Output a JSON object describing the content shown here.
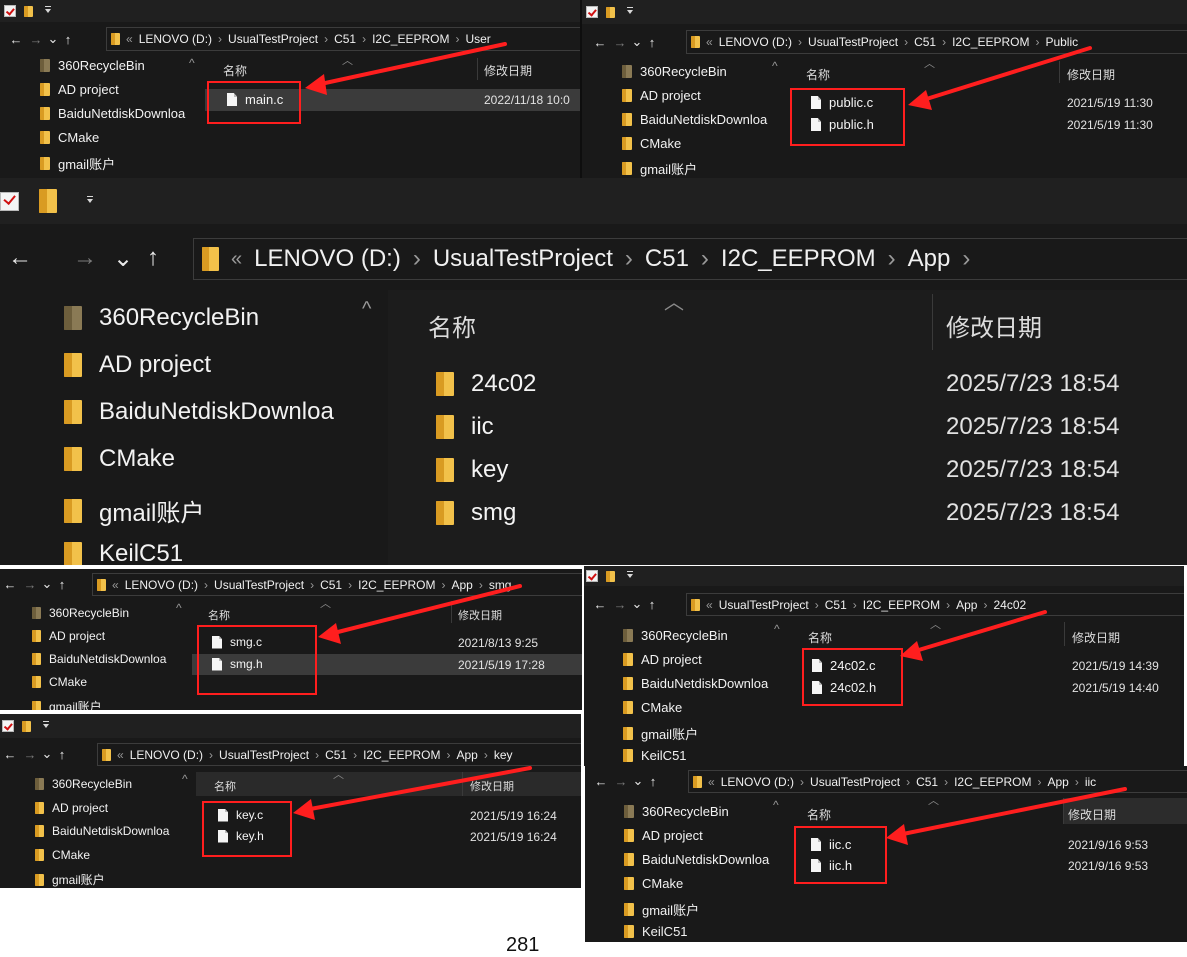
{
  "tree": [
    "360RecycleBin",
    "AD project",
    "BaiduNetdiskDownloa",
    "CMake",
    "gmail账户",
    "KeilC51"
  ],
  "crumb": {
    "drive": "LENOVO (D:)",
    "project": "UsualTestProject",
    "c51": "C51",
    "eeprom": "I2C_EEPROM",
    "user": "User",
    "public": "Public",
    "app": "App",
    "smg": "smg",
    "key": "key",
    "c24": "24c02",
    "iic": "iic"
  },
  "glyphs": {
    "overflow": "«",
    "sep": "›",
    "back": "←",
    "forward": "→",
    "recent": "⌄",
    "up": "↑",
    "sort": "︿",
    "scroll_up": "^"
  },
  "columns": {
    "name": "名称",
    "date": "修改日期"
  },
  "user_files": [
    {
      "name": "main.c",
      "date": "2022/11/18 10:0"
    }
  ],
  "public_files": [
    {
      "name": "public.c",
      "date": "2021/5/19 11:30"
    },
    {
      "name": "public.h",
      "date": "2021/5/19 11:30"
    }
  ],
  "app_folders": [
    {
      "name": "24c02",
      "date": "2025/7/23 18:54"
    },
    {
      "name": "iic",
      "date": "2025/7/23 18:54"
    },
    {
      "name": "key",
      "date": "2025/7/23 18:54"
    },
    {
      "name": "smg",
      "date": "2025/7/23 18:54"
    }
  ],
  "smg_files": [
    {
      "name": "smg.c",
      "date": "2021/8/13 9:25"
    },
    {
      "name": "smg.h",
      "date": "2021/5/19 17:28"
    }
  ],
  "c24_files": [
    {
      "name": "24c02.c",
      "date": "2021/5/19 14:39"
    },
    {
      "name": "24c02.h",
      "date": "2021/5/19 14:40"
    }
  ],
  "key_files": [
    {
      "name": "key.c",
      "date": "2021/5/19 16:24"
    },
    {
      "name": "key.h",
      "date": "2021/5/19 16:24"
    }
  ],
  "iic_files": [
    {
      "name": "iic.c",
      "date": "2021/9/16 9:53"
    },
    {
      "name": "iic.h",
      "date": "2021/9/16 9:53"
    }
  ],
  "page_number": "281",
  "colors": {
    "highlight": "#ff1e1e",
    "arrow": "#ff1e1e",
    "window_bg": "#191919",
    "folder": "#f2c14a"
  }
}
